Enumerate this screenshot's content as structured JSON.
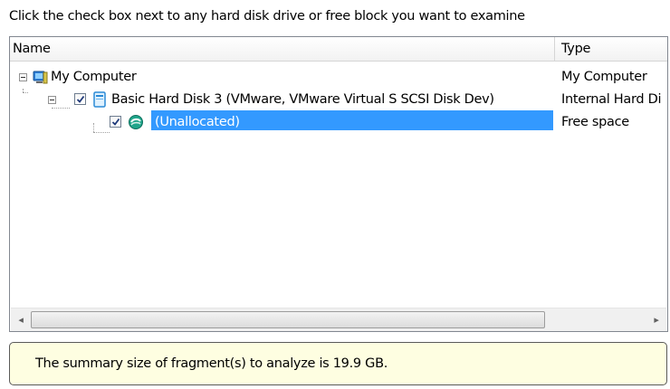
{
  "instruction": "Click the check box next to any hard disk drive or free block you want to examine",
  "columns": {
    "name": "Name",
    "type": "Type"
  },
  "tree": {
    "root": {
      "label": "My Computer",
      "type": "My Computer",
      "icon": "computer-icon"
    },
    "disk": {
      "label": "Basic Hard Disk 3 (VMware, VMware Virtual S SCSI Disk Dev)",
      "type": "Internal Hard Di",
      "icon": "hard-disk-icon",
      "checked": true
    },
    "partition": {
      "label": "(Unallocated)",
      "type": "Free space",
      "icon": "unallocated-space-icon",
      "checked": true,
      "selected": true
    }
  },
  "scrollbar": {
    "left_arrow": "◂",
    "right_arrow": "▸"
  },
  "summary": "The summary size of fragment(s) to analyze is 19.9 GB.",
  "colors": {
    "selection": "#3399ff",
    "summary_bg": "#fefee1"
  }
}
